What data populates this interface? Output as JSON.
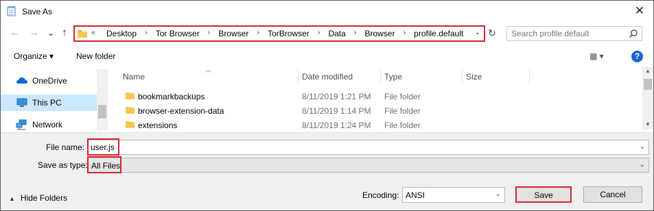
{
  "window": {
    "title": "Save As",
    "close_glyph": "✕"
  },
  "nav": {
    "back_glyph": "←",
    "forward_glyph": "→",
    "recent_glyph": "⌄",
    "up_glyph": "↑",
    "refresh_glyph": "↻",
    "breadcrumb_prefix": "«",
    "breadcrumb": [
      "Desktop",
      "Tor Browser",
      "Browser",
      "TorBrowser",
      "Data",
      "Browser",
      "profile.default"
    ],
    "breadcrumb_sep": "›",
    "search_placeholder": "Search profile.default"
  },
  "toolbar": {
    "organize_label": "Organize ▾",
    "new_folder_label": "New folder",
    "view_glyph": "▦ ▾",
    "help_glyph": "?"
  },
  "sidebar": {
    "items": [
      {
        "label": "OneDrive",
        "icon": "cloud-icon",
        "selected": false
      },
      {
        "label": "This PC",
        "icon": "computer-icon",
        "selected": true
      },
      {
        "label": "Network",
        "icon": "network-icon",
        "selected": false
      }
    ]
  },
  "filelist": {
    "columns": [
      "Name",
      "Date modified",
      "Type",
      "Size"
    ],
    "rows": [
      {
        "name": "bookmarkbackups",
        "date": "8/11/2019 1:21 PM",
        "type": "File folder"
      },
      {
        "name": "browser-extension-data",
        "date": "8/11/2019 1:14 PM",
        "type": "File folder"
      },
      {
        "name": "extensions",
        "date": "8/11/2019 1:24 PM",
        "type": "File folder"
      }
    ]
  },
  "form": {
    "file_name_label": "File name:",
    "file_name_value": "user.js",
    "save_type_label": "Save as type:",
    "save_type_value": "All Files",
    "encoding_label": "Encoding:",
    "encoding_value": "ANSI",
    "hide_folders_label": "Hide Folders",
    "save_label": "Save",
    "cancel_label": "Cancel"
  },
  "colors": {
    "highlight": "#d6202e",
    "selected_bg": "#cce8ff",
    "folder": "#f3c94f",
    "accent": "#1b64d2"
  }
}
